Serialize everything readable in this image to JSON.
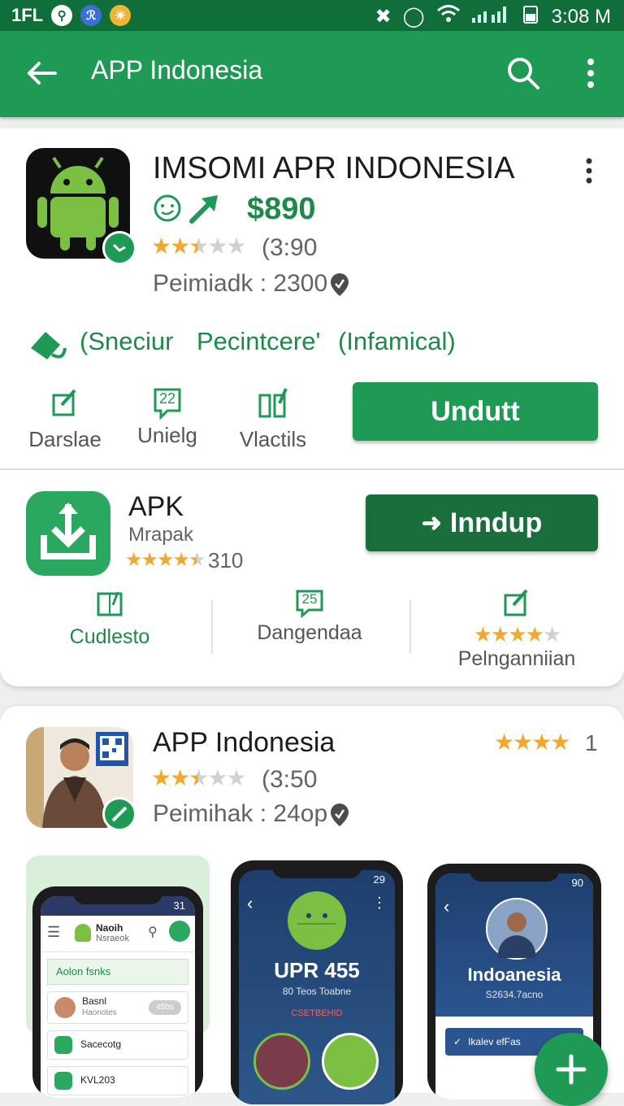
{
  "status_bar": {
    "carrier": "1FL",
    "time": "3:08 M"
  },
  "app_bar": {
    "title": "APP Indonesia"
  },
  "featured": {
    "name": "IMSOMI APR INDONESIA",
    "price": "$890",
    "rating_text": "(3:90",
    "rating_stars": 2.5,
    "publisher": "Peimiadk : 2300",
    "tags": [
      "(Sneciur",
      "Pecintcere'",
      "(Infamical)"
    ],
    "actions": [
      {
        "label": "Darslae",
        "icon": "edit-icon"
      },
      {
        "label": "Unielg",
        "icon": "chat-badge-icon",
        "badge": "22"
      },
      {
        "label": "Vlactils",
        "icon": "compare-icon"
      }
    ],
    "button": "Undutt"
  },
  "apk": {
    "name": "APK",
    "subtitle": "Mrapak",
    "rating_stars": 4.5,
    "rating_count": "310",
    "button": "Inndup",
    "actions": [
      {
        "label": "Cudlesto",
        "icon": "calendar-icon"
      },
      {
        "label": "Dangendaa",
        "icon": "chat-badge-icon",
        "badge": "25"
      },
      {
        "label": "Pelnganniian",
        "icon": "edit-icon",
        "stars": 4
      }
    ]
  },
  "app_indonesia": {
    "name": "APP Indonesia",
    "rating_text": "(3:50",
    "rating_stars": 2.5,
    "publisher": "Peimihak : 24op",
    "top_stars": 4,
    "top_count": "1",
    "screenshots": [
      {
        "status": "31",
        "header_title": "Naoih",
        "header_sub": "Nsraeok",
        "section": "Aolon fsnks",
        "rows": [
          {
            "title": "Basnl",
            "sub": "Haonotes",
            "pill": "45bs"
          },
          {
            "title": "Sacecotg"
          },
          {
            "title": "KVL203"
          }
        ]
      },
      {
        "status": "29",
        "title": "UPR 455",
        "subtitle": "80 Teos Toabne",
        "tag": "CSETBEHID"
      },
      {
        "status": "90",
        "title": "Indoanesia",
        "subtitle": "S2634.7acno",
        "card_label": "Ikalev efFas"
      }
    ]
  },
  "colors": {
    "primary": "#1e9a55",
    "primary_dark": "#1a6e3c",
    "star": "#f2a830"
  }
}
